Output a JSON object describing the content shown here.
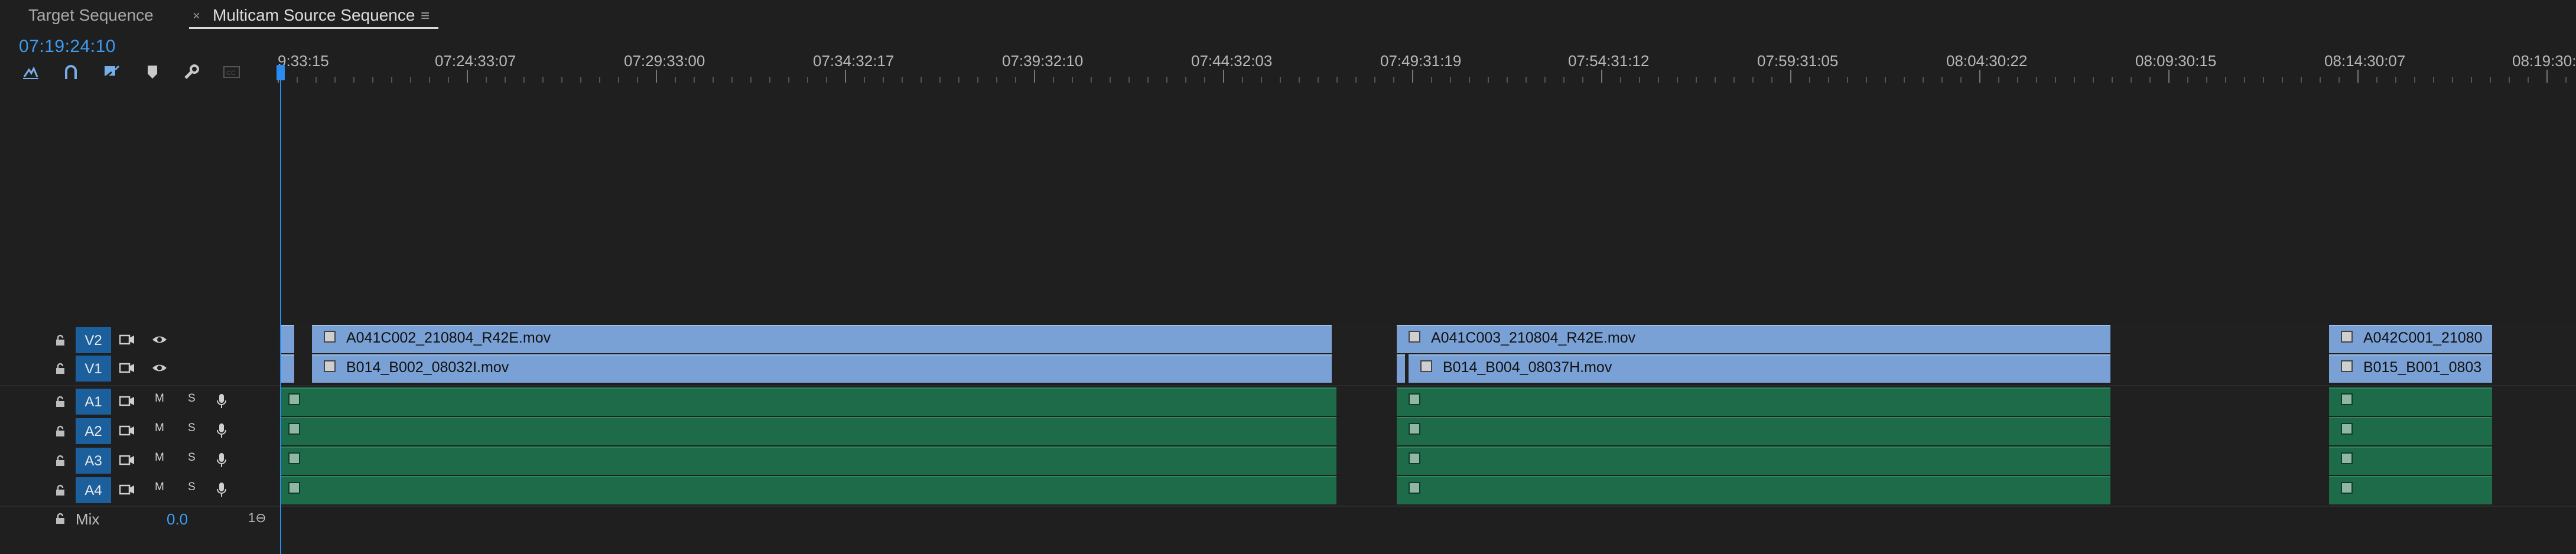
{
  "tabs": [
    {
      "label": "Target Sequence",
      "active": false
    },
    {
      "label": "Multicam Source Sequence",
      "active": true
    }
  ],
  "tab_close_glyph": "×",
  "tab_menu_glyph": "≡",
  "timecode": "07:19:24:10",
  "toolbar_icons": [
    "snap-icon",
    "linked-selection-icon",
    "add-marker-icon",
    "marker-icon",
    "wrench-icon",
    "captions-icon"
  ],
  "ruler": {
    "labels": [
      "9:33:15",
      "07:24:33:07",
      "07:29:33:00",
      "07:34:32:17",
      "07:39:32:10",
      "07:44:32:03",
      "07:49:31:19",
      "07:54:31:12",
      "07:59:31:05",
      "08:04:30:22",
      "08:09:30:15",
      "08:14:30:07",
      "08:19:30:"
    ]
  },
  "tracks": {
    "video": [
      {
        "id": "V2",
        "clips": [
          "A041C002_210804_R42E.mov",
          "A041C003_210804_R42E.mov",
          "A042C001_21080"
        ]
      },
      {
        "id": "V1",
        "clips": [
          "B014_B002_08032I.mov",
          "B014_B004_08037H.mov",
          "B015_B001_0803"
        ]
      }
    ],
    "audio": [
      {
        "id": "A1",
        "m": "M",
        "s": "S"
      },
      {
        "id": "A2",
        "m": "M",
        "s": "S"
      },
      {
        "id": "A3",
        "m": "M",
        "s": "S"
      },
      {
        "id": "A4",
        "m": "M",
        "s": "S"
      }
    ]
  },
  "mix": {
    "label": "Mix",
    "value": "0.0",
    "end_glyph": "1⊖"
  },
  "colors": {
    "accent": "#2a8cf0",
    "video_clip": "#7aa1d6",
    "audio_clip": "#1e6b49",
    "track_target": "#1b5f9c",
    "background": "#1f1f1f"
  }
}
